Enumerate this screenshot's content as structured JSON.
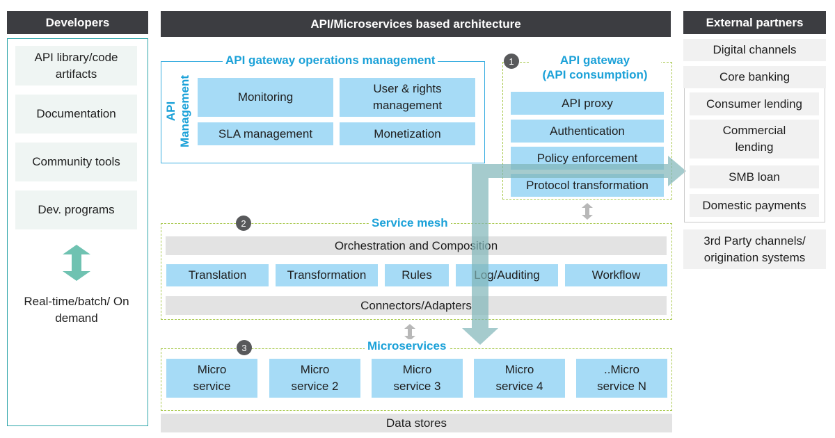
{
  "headers": {
    "developers": "Developers",
    "architecture": "API/Microservices based architecture",
    "external": "External partners"
  },
  "developers": {
    "items": [
      "API library/code artifacts",
      "Documentation",
      "Community tools",
      "Dev. programs"
    ],
    "arrow_icon": "double-arrow-vertical",
    "mode_label": "Real-time/batch/ On demand"
  },
  "api_management": {
    "title": "API gateway operations management",
    "side_label_line1": "API",
    "side_label_line2": "Management",
    "items": [
      "Monitoring",
      "User & rights management",
      "SLA management",
      "Monetization"
    ]
  },
  "api_gateway": {
    "badge": "1",
    "title_line1": "API gateway",
    "title_line2": "(API consumption)",
    "items": [
      "API proxy",
      "Authentication",
      "Policy enforcement",
      "Protocol transformation"
    ]
  },
  "service_mesh": {
    "badge": "2",
    "title": "Service mesh",
    "orchestration": "Orchestration and Composition",
    "items": [
      "Translation",
      "Transformation",
      "Rules",
      "Log/Auditing",
      "Workflow"
    ],
    "connectors": "Connectors/Adapters"
  },
  "microservices": {
    "badge": "3",
    "title": "Microservices",
    "items": [
      "Micro service",
      "Micro service 2",
      "Micro service 3",
      "Micro service 4",
      "..Micro service N"
    ]
  },
  "data_stores": "Data stores",
  "external_partners": {
    "digital_channels": "Digital channels",
    "core_banking": "Core banking",
    "core_items": [
      "Consumer lending",
      "Commercial lending",
      "SMB loan",
      "Domestic payments"
    ],
    "third_party": "3rd Party channels/ origination systems"
  },
  "colors": {
    "header_bg": "#3c3d41",
    "accent_blue": "#1ba1d8",
    "box_blue": "#a6dbf6",
    "box_grey": "#e3e3e3",
    "teal_arrow": "#6fc2b1",
    "flow_arrow": "#8fbcbf",
    "dashed_green": "#a9c94f"
  }
}
